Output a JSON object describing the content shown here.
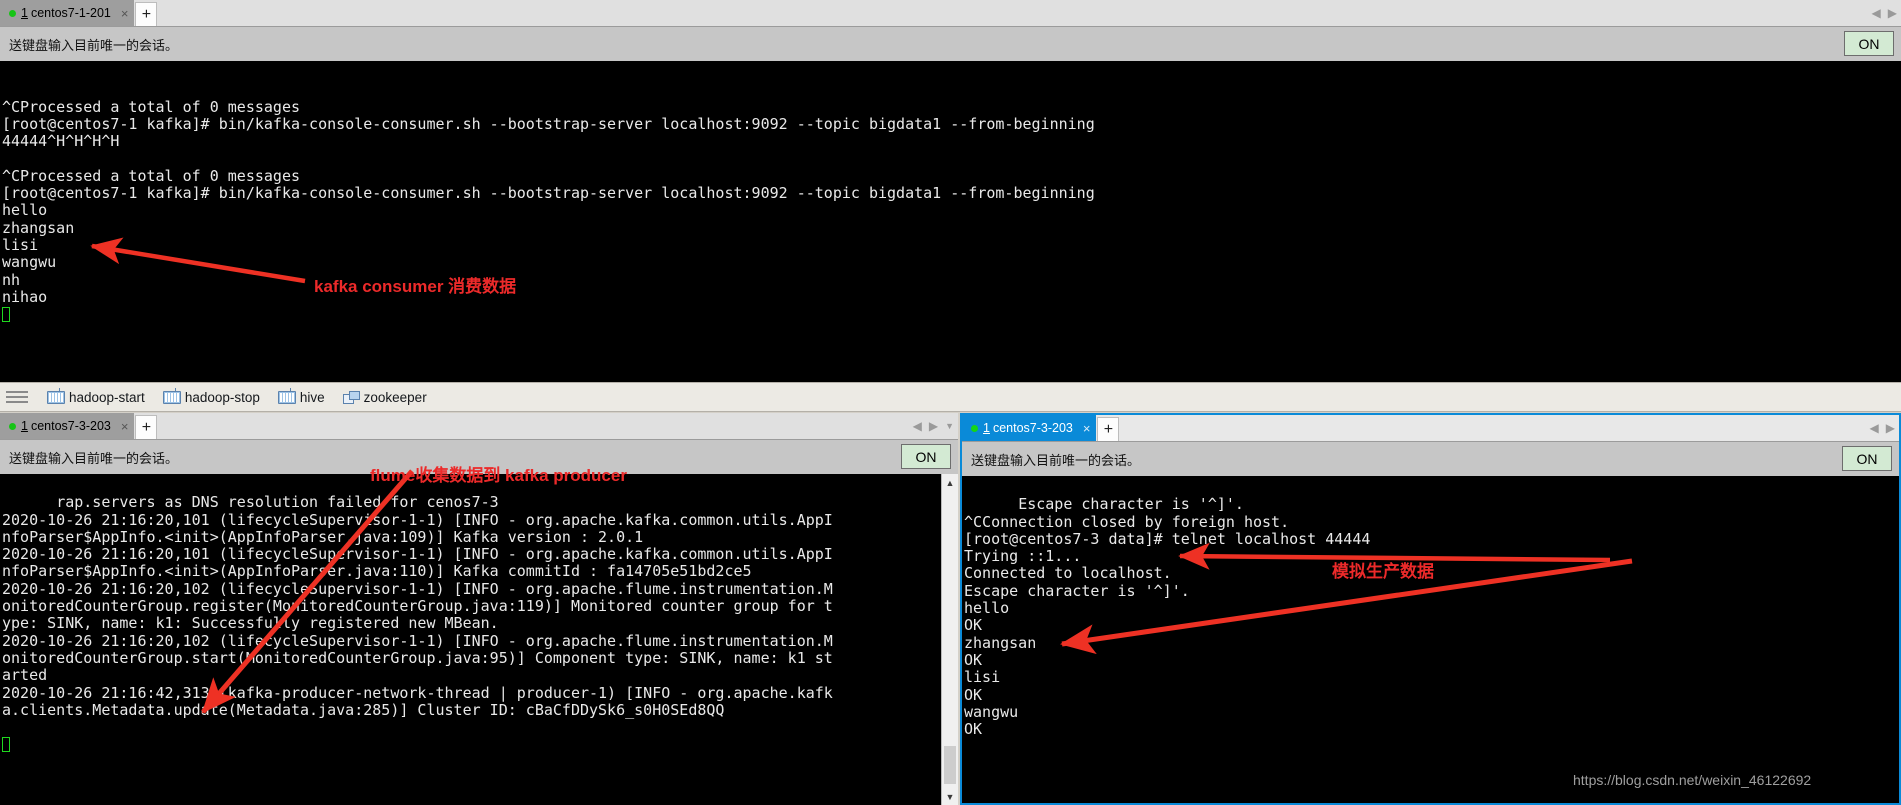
{
  "colors": {
    "accent_blue": "#0a8ad8",
    "annotation_red": "#ec2a2a",
    "terminal_bg": "#000000",
    "terminal_fg": "#e9e9e9",
    "cursor_green": "#1fd81f",
    "on_button_bg": "#d3ead3",
    "tab_selected_gray": "#9e9e9e",
    "chrome_bg": "#c6c6c6"
  },
  "top_window": {
    "tab": {
      "number": "1",
      "label": "centos7-1-201",
      "close": "×"
    },
    "new_tab": "+",
    "nav": {
      "prev": "◀",
      "next": "▶"
    },
    "hint": "送键盘输入目前唯一的会话。",
    "on_button": "ON",
    "terminal_lines": [
      "",
      "^CProcessed a total of 0 messages",
      "[root@centos7-1 kafka]# bin/kafka-console-consumer.sh --bootstrap-server localhost:9092 --topic bigdata1 --from-beginning",
      "44444^H^H^H^H",
      "",
      "^CProcessed a total of 0 messages",
      "[root@centos7-1 kafka]# bin/kafka-console-consumer.sh --bootstrap-server localhost:9092 --topic bigdata1 --from-beginning",
      "hello",
      "zhangsan",
      "lisi",
      "wangwu",
      "nh",
      "nihao"
    ]
  },
  "bookmark_bar": {
    "menu_icon": "hamburger-menu-icon",
    "items": [
      {
        "label": "hadoop-start",
        "icon": "keyboard-icon"
      },
      {
        "label": "hadoop-stop",
        "icon": "keyboard-icon"
      },
      {
        "label": "hive",
        "icon": "keyboard-icon"
      },
      {
        "label": "zookeeper",
        "icon": "window-icon"
      }
    ]
  },
  "left_window": {
    "tab": {
      "number": "1",
      "label": "centos7-3-203",
      "close": "×"
    },
    "new_tab": "+",
    "nav": {
      "prev": "◀",
      "next": "▶",
      "menu": "▼"
    },
    "hint": "送键盘输入目前唯一的会话。",
    "on_button": "ON",
    "terminal_lines": [
      "rap.servers as DNS resolution failed for cenos7-3",
      "2020-10-26 21:16:20,101 (lifecycleSupervisor-1-1) [INFO - org.apache.kafka.common.utils.AppI",
      "nfoParser$AppInfo.<init>(AppInfoParser.java:109)] Kafka version : 2.0.1",
      "2020-10-26 21:16:20,101 (lifecycleSupervisor-1-1) [INFO - org.apache.kafka.common.utils.AppI",
      "nfoParser$AppInfo.<init>(AppInfoParser.java:110)] Kafka commitId : fa14705e51bd2ce5",
      "2020-10-26 21:16:20,102 (lifecycleSupervisor-1-1) [INFO - org.apache.flume.instrumentation.M",
      "onitoredCounterGroup.register(MonitoredCounterGroup.java:119)] Monitored counter group for t",
      "ype: SINK, name: k1: Successfully registered new MBean.",
      "2020-10-26 21:16:20,102 (lifecycleSupervisor-1-1) [INFO - org.apache.flume.instrumentation.M",
      "onitoredCounterGroup.start(MonitoredCounterGroup.java:95)] Component type: SINK, name: k1 st",
      "arted",
      "2020-10-26 21:16:42,313 (kafka-producer-network-thread | producer-1) [INFO - org.apache.kafk",
      "a.clients.Metadata.update(Metadata.java:285)] Cluster ID: cBaCfDDySk6_s0H0SEd8QQ"
    ]
  },
  "right_window": {
    "tab": {
      "number": "1",
      "label": "centos7-3-203",
      "close": "×"
    },
    "new_tab": "+",
    "nav": {
      "prev": "◀",
      "next": "▶"
    },
    "hint": "送键盘输入目前唯一的会话。",
    "on_button": "ON",
    "terminal_lines": [
      "Escape character is '^]'.",
      "^CConnection closed by foreign host.",
      "[root@centos7-3 data]# telnet localhost 44444",
      "Trying ::1...",
      "Connected to localhost.",
      "Escape character is '^]'.",
      "hello",
      "OK",
      "zhangsan",
      "OK",
      "lisi",
      "OK",
      "wangwu",
      "OK"
    ]
  },
  "annotations": [
    {
      "id": "anno-kafka-consumer",
      "text": "kafka consumer 消费数据",
      "font_size": 17
    },
    {
      "id": "anno-flume-producer",
      "text": "flume收集数据到 kafka producer",
      "font_size": 17
    },
    {
      "id": "anno-mock-data",
      "text": "模拟生产数据",
      "font_size": 17
    }
  ],
  "watermark": "https://blog.csdn.net/weixin_46122692"
}
